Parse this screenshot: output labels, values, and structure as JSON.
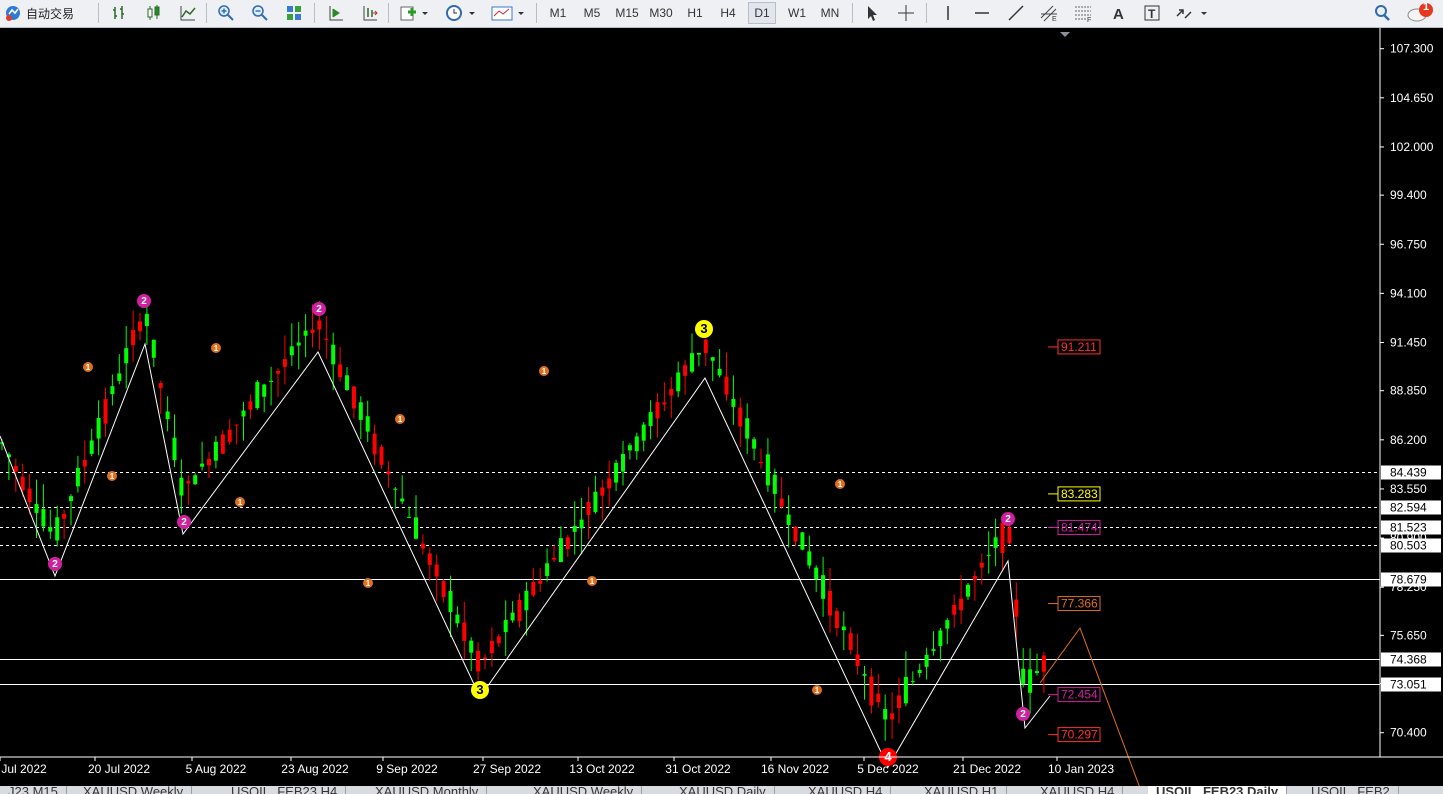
{
  "toolbar": {
    "auto_trading_label": "自动交易",
    "timeframes": [
      "M1",
      "M5",
      "M15",
      "M30",
      "H1",
      "H4",
      "D1",
      "W1",
      "MN"
    ],
    "active_timeframe": "D1",
    "notification_count": "1"
  },
  "chart": {
    "price_axis": [
      "107.300",
      "104.650",
      "102.000",
      "99.400",
      "96.750",
      "94.100",
      "91.450",
      "88.850",
      "86.200",
      "83.550",
      "80.900",
      "78.250",
      "75.650",
      "73.051",
      "70.400"
    ],
    "time_axis": [
      "Jul 2022",
      "20 Jul 2022",
      "5 Aug 2022",
      "23 Aug 2022",
      "9 Sep 2022",
      "27 Sep 2022",
      "13 Oct 2022",
      "31 Oct 2022",
      "16 Nov 2022",
      "5 Dec 2022",
      "21 Dec 2022",
      "10 Jan 2023"
    ],
    "horizontal_levels": [
      {
        "label": "84.439",
        "style": "dashed"
      },
      {
        "label": "82.594",
        "style": "dashed"
      },
      {
        "label": "81.523",
        "style": "dashed"
      },
      {
        "label": "80.503",
        "style": "dashed"
      },
      {
        "label": "78.679",
        "style": "solid"
      },
      {
        "label": "74.368",
        "style": "solid"
      },
      {
        "label": "73.051",
        "style": "solid"
      }
    ],
    "projection_labels": [
      {
        "label": "91.211",
        "color": "#ff3030"
      },
      {
        "label": "83.283",
        "color": "#ffff00"
      },
      {
        "label": "81.474",
        "color": "#d020a0"
      },
      {
        "label": "77.366",
        "color": "#e07020"
      },
      {
        "label": "72.454",
        "color": "#d020a0"
      },
      {
        "label": "70.297",
        "color": "#ff3030"
      }
    ],
    "wave_labels": [
      "1",
      "2",
      "3",
      "4"
    ],
    "colors": {
      "bull": "#00ff00",
      "bear": "#ff0000",
      "zigzag": "#ffffff",
      "wave1": "#e07020",
      "wave2": "#d020a0",
      "wave3": "#ffff00",
      "wave4": "#ff0000"
    }
  },
  "tabs": [
    "J23 M15",
    "XAUUSD,Weekly",
    "USOIL_FEB23,H4",
    "XAUUSD,Monthly",
    "XAUUSD,Weekly",
    "XAUUSD,Daily",
    "XAUUSD,H4",
    "XAUUSD,H1",
    "XAUUSD,H4",
    "USOIL_FEB23,Daily",
    "USOIL_FEB2"
  ],
  "active_tab": "USOIL_FEB23,Daily"
}
